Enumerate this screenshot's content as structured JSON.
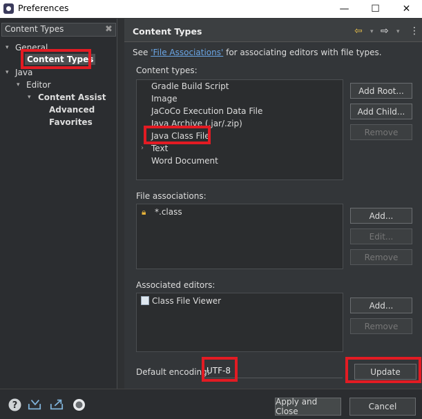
{
  "window": {
    "title": "Preferences",
    "minimize": "—",
    "maximize": "☐",
    "close": "✕"
  },
  "sidebar": {
    "filter_value": "Content Types",
    "filter_clear": "✖",
    "items": [
      {
        "label": "General"
      },
      {
        "label": "Content Types"
      },
      {
        "label": "Java"
      },
      {
        "label": "Editor"
      },
      {
        "label": "Content Assist"
      },
      {
        "label": "Advanced"
      },
      {
        "label": "Favorites"
      }
    ]
  },
  "page": {
    "title": "Content Types",
    "description_prefix": "See ",
    "description_link": "'File Associations'",
    "description_suffix": " for associating editors with file types."
  },
  "content_types": {
    "label": "Content types:",
    "items": [
      {
        "label": "Gradle Build Script"
      },
      {
        "label": "Image"
      },
      {
        "label": "JaCoCo Execution Data File"
      },
      {
        "label": "Java Archive (.jar/.zip)"
      },
      {
        "label": "Java Class File"
      },
      {
        "label": "Text"
      },
      {
        "label": "Word Document"
      }
    ],
    "buttons": {
      "add_root": "Add Root...",
      "add_child": "Add Child...",
      "remove": "Remove"
    }
  },
  "file_associations": {
    "label": "File associations:",
    "items": [
      {
        "label": "*.class"
      }
    ],
    "buttons": {
      "add": "Add...",
      "edit": "Edit...",
      "remove": "Remove"
    }
  },
  "associated_editors": {
    "label": "Associated editors:",
    "items": [
      {
        "label": "Class File Viewer"
      }
    ],
    "buttons": {
      "add": "Add...",
      "remove": "Remove"
    }
  },
  "encoding": {
    "label": "Default encoding:",
    "value": "UTF-8",
    "update": "Update"
  },
  "footer": {
    "apply_close": "Apply and Close",
    "cancel": "Cancel"
  },
  "colors": {
    "highlight": "#e31b23",
    "link": "#6aa6e6",
    "background": "#333639"
  }
}
